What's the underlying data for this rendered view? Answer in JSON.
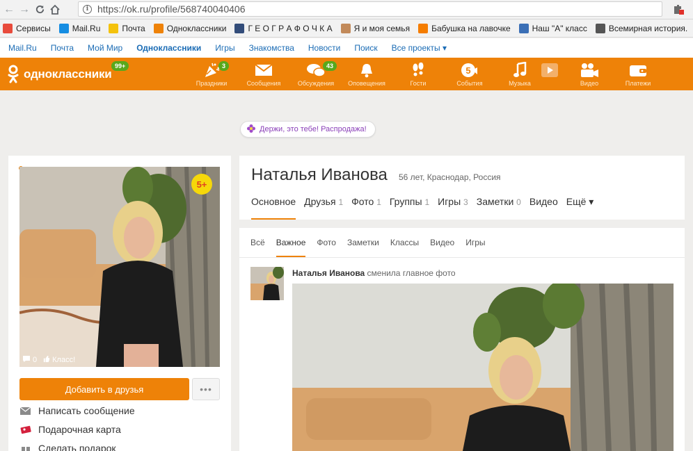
{
  "browser": {
    "url": "https://ok.ru/profile/568740040406",
    "bookmarks": [
      {
        "label": "Сервисы",
        "icon": "apps-icon",
        "color": "#e84b3c"
      },
      {
        "label": "Mail.Ru",
        "icon": "mailru-icon",
        "color": "#168de2"
      },
      {
        "label": "Почта",
        "icon": "mail-icon",
        "color": "#f4c20d"
      },
      {
        "label": "Одноклассники",
        "icon": "ok-icon",
        "color": "#ee8208"
      },
      {
        "label": "Г Е О Г Р А Ф О Ч К А",
        "icon": "globe-icon",
        "color": "#334d7a"
      },
      {
        "label": "Я и моя семья",
        "icon": "person-icon",
        "color": "#c28a5a"
      },
      {
        "label": "Бабушка на лавочке",
        "icon": "blogger-icon",
        "color": "#f57d00"
      },
      {
        "label": "Наш \"А\" класс",
        "icon": "folder-icon",
        "color": "#3b6fb6"
      },
      {
        "label": "Всемирная история.",
        "icon": "history-icon",
        "color": "#555555"
      }
    ]
  },
  "portal": {
    "links": [
      {
        "label": "Mail.Ru",
        "active": false
      },
      {
        "label": "Почта",
        "active": false
      },
      {
        "label": "Мой Мир",
        "active": false
      },
      {
        "label": "Одноклассники",
        "active": true
      },
      {
        "label": "Игры",
        "active": false
      },
      {
        "label": "Знакомства",
        "active": false
      },
      {
        "label": "Новости",
        "active": false
      },
      {
        "label": "Поиск",
        "active": false
      },
      {
        "label": "Все проекты ▾",
        "active": false
      }
    ]
  },
  "topbar": {
    "logo_text": "одноклассники",
    "logo_badge": "99+",
    "items": [
      {
        "label": "Праздники",
        "icon": "party-icon",
        "badge": "3"
      },
      {
        "label": "Сообщения",
        "icon": "envelope-icon",
        "badge": ""
      },
      {
        "label": "Обсуждения",
        "icon": "chat-bubbles-icon",
        "badge": "43"
      },
      {
        "label": "Оповещения",
        "icon": "bell-icon",
        "badge": ""
      },
      {
        "label": "Гости",
        "icon": "footprints-icon",
        "badge": ""
      },
      {
        "label": "События",
        "icon": "events-icon",
        "badge": ""
      },
      {
        "label": "Музыка",
        "icon": "music-note-icon",
        "badge": ""
      },
      {
        "label": "",
        "icon": "play-icon",
        "badge": ""
      },
      {
        "label": "Видео",
        "icon": "video-camera-icon",
        "badge": ""
      },
      {
        "label": "Платежи",
        "icon": "wallet-icon",
        "badge": ""
      }
    ],
    "accent_color": "#ee8208"
  },
  "promo": {
    "text": "Держи, это тебе! Распродажа!"
  },
  "profile": {
    "name": "Наталья Иванова",
    "meta": "56 лет, Краснодар, Россия",
    "avatar_badge": "5+",
    "photo_comments": "0",
    "photo_likes_label": "Класс!",
    "add_friend_label": "Добавить в друзья",
    "more_label": "•••",
    "actions": [
      {
        "label": "Написать сообщение",
        "icon": "envelope-icon"
      },
      {
        "label": "Подарочная карта",
        "icon": "gift-card-icon"
      },
      {
        "label": "Сделать подарок",
        "icon": "gift-icon"
      }
    ],
    "tabs": [
      {
        "label": "Основное",
        "count": "",
        "active": true
      },
      {
        "label": "Друзья",
        "count": "1",
        "active": false
      },
      {
        "label": "Фото",
        "count": "1",
        "active": false
      },
      {
        "label": "Группы",
        "count": "1",
        "active": false
      },
      {
        "label": "Игры",
        "count": "3",
        "active": false
      },
      {
        "label": "Заметки",
        "count": "0",
        "active": false
      },
      {
        "label": "Видео",
        "count": "",
        "active": false
      },
      {
        "label": "Ещё ▾",
        "count": "",
        "active": false
      }
    ]
  },
  "feed": {
    "tabs": [
      {
        "label": "Всё",
        "active": false
      },
      {
        "label": "Важное",
        "active": true
      },
      {
        "label": "Фото",
        "active": false
      },
      {
        "label": "Заметки",
        "active": false
      },
      {
        "label": "Классы",
        "active": false
      },
      {
        "label": "Видео",
        "active": false
      },
      {
        "label": "Игры",
        "active": false
      }
    ],
    "post_author": "Наталья Иванова",
    "post_action": " сменила главное фото"
  }
}
